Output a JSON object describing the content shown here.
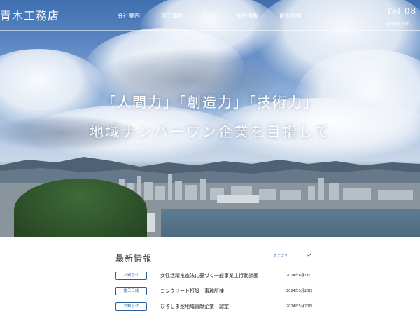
{
  "header": {
    "logo": "青木工務店",
    "nav": [
      "会社案内",
      "施工事例",
      "CSR",
      "採用情報",
      "最新情報"
    ],
    "tel": "Tel 08",
    "hours": "受付時間 8:00 -"
  },
  "hero": {
    "title": "「人間力」「創造力」「技術力」",
    "subtitle": "地域ナンバーワン企業を目指して"
  },
  "news": {
    "heading": "最新情報",
    "category_label": "カテゴリ",
    "items": [
      {
        "badge": "お知らせ",
        "title": "女性活躍推進法に基づく一般事業主行動計画",
        "date": "2024年6月1日"
      },
      {
        "badge": "施工日誌",
        "title": "コンクリート打設　事務所棟",
        "date": "2024年5月28日"
      },
      {
        "badge": "お知らせ",
        "title": "ひろしま型地域貢献企業　認定",
        "date": "2024年5月20日"
      }
    ]
  },
  "colors": {
    "accent": "#2b5f9e",
    "header_text": "#ffffff"
  }
}
